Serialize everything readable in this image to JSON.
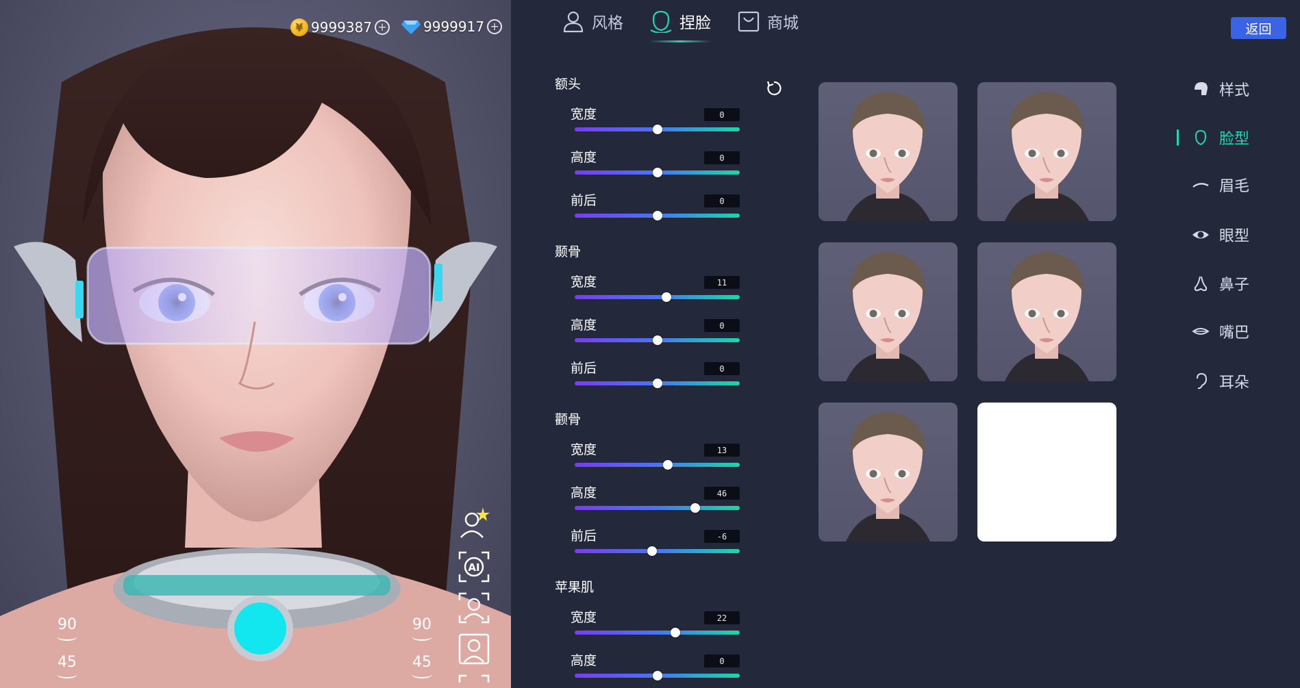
{
  "currency": {
    "coins": "9999387",
    "gems": "9999917",
    "coin_symbol": "¥"
  },
  "tabs": [
    {
      "label": "风格",
      "icon": "person-icon"
    },
    {
      "label": "捏脸",
      "icon": "face-outline-icon",
      "active": true
    },
    {
      "label": "商城",
      "icon": "shop-bag-icon"
    }
  ],
  "back_button": "返回",
  "viewport": {
    "rotate_left_top": "90",
    "rotate_left_bottom": "45",
    "rotate_right_top": "90",
    "rotate_right_bottom": "45"
  },
  "slider_groups": [
    {
      "title": "额头",
      "rows": [
        {
          "label": "宽度",
          "value": "0",
          "fraction": 0.5
        },
        {
          "label": "高度",
          "value": "0",
          "fraction": 0.5
        },
        {
          "label": "前后",
          "value": "0",
          "fraction": 0.5
        }
      ]
    },
    {
      "title": "颞骨",
      "rows": [
        {
          "label": "宽度",
          "value": "11",
          "fraction": 0.555
        },
        {
          "label": "高度",
          "value": "0",
          "fraction": 0.5
        },
        {
          "label": "前后",
          "value": "0",
          "fraction": 0.5
        }
      ]
    },
    {
      "title": "颧骨",
      "rows": [
        {
          "label": "宽度",
          "value": "13",
          "fraction": 0.565
        },
        {
          "label": "高度",
          "value": "46",
          "fraction": 0.73
        },
        {
          "label": "前后",
          "value": "-6",
          "fraction": 0.47
        }
      ]
    },
    {
      "title": "苹果肌",
      "rows": [
        {
          "label": "宽度",
          "value": "22",
          "fraction": 0.61
        },
        {
          "label": "高度",
          "value": "0",
          "fraction": 0.5
        }
      ]
    }
  ],
  "presets": [
    {
      "id": "face-1",
      "empty": false
    },
    {
      "id": "face-2",
      "empty": false
    },
    {
      "id": "face-3",
      "empty": false
    },
    {
      "id": "face-4",
      "empty": false
    },
    {
      "id": "face-5",
      "empty": false
    },
    {
      "id": "face-6",
      "empty": true
    }
  ],
  "categories": [
    {
      "label": "样式",
      "icon": "hair-style-icon"
    },
    {
      "label": "脸型",
      "icon": "face-shape-icon",
      "active": true
    },
    {
      "label": "眉毛",
      "icon": "eyebrow-icon"
    },
    {
      "label": "眼型",
      "icon": "eye-icon"
    },
    {
      "label": "鼻子",
      "icon": "nose-icon"
    },
    {
      "label": "嘴巴",
      "icon": "mouth-icon"
    },
    {
      "label": "耳朵",
      "icon": "ear-icon"
    }
  ],
  "colors": {
    "background": "#23283b",
    "accent_teal": "#22d7b0",
    "button_blue": "#3b63e6",
    "slider_start": "#7a3cf0",
    "slider_end": "#19d9a6"
  }
}
